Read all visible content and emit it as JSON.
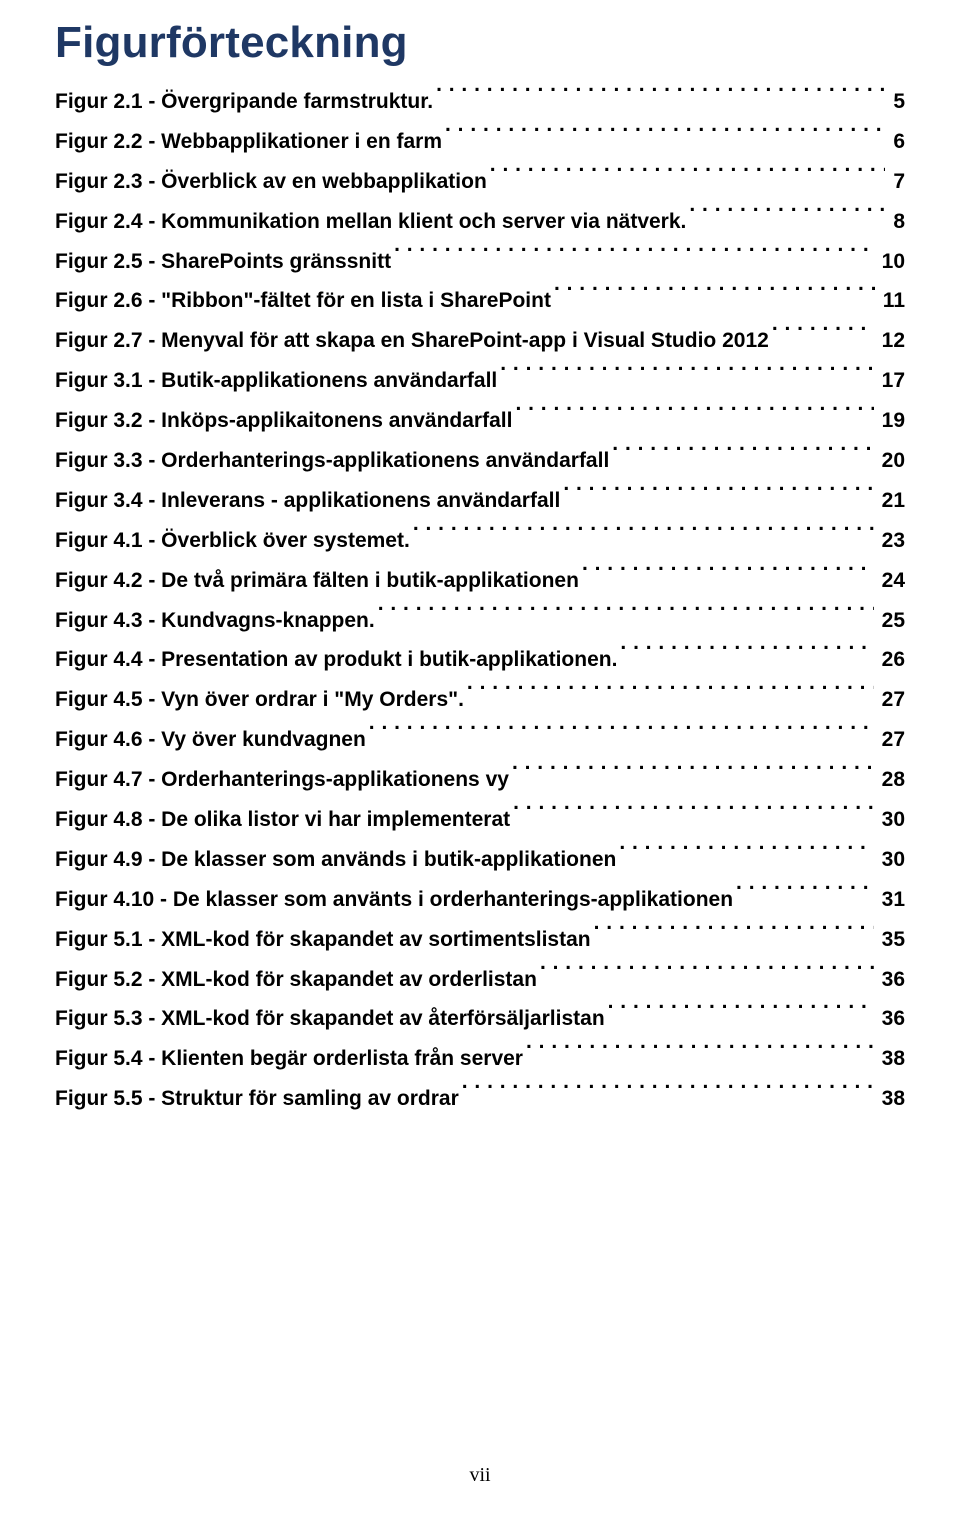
{
  "title": "Figurförteckning",
  "footer": "vii",
  "entries": [
    {
      "label": "Figur 2.1 - Övergripande farmstruktur.",
      "page": "5"
    },
    {
      "label": "Figur 2.2 - Webbapplikationer i en farm",
      "page": "6"
    },
    {
      "label": "Figur 2.3 - Överblick av en webbapplikation",
      "page": "7"
    },
    {
      "label": "Figur 2.4 - Kommunikation mellan klient och server via nätverk.",
      "page": "8"
    },
    {
      "label": "Figur 2.5 - SharePoints gränssnitt",
      "page": "10"
    },
    {
      "label": "Figur 2.6 - \"Ribbon\"-fältet för en lista i SharePoint",
      "page": "11"
    },
    {
      "label": "Figur 2.7 - Menyval för att skapa en SharePoint-app i Visual Studio 2012",
      "page": "12"
    },
    {
      "label": "Figur 3.1 - Butik-applikationens användarfall",
      "page": "17"
    },
    {
      "label": "Figur 3.2 - Inköps-applikaitonens användarfall",
      "page": "19"
    },
    {
      "label": "Figur 3.3 - Orderhanterings-applikationens användarfall",
      "page": "20"
    },
    {
      "label": "Figur 3.4 - Inleverans - applikationens användarfall",
      "page": "21"
    },
    {
      "label": "Figur 4.1 - Överblick över systemet.",
      "page": "23"
    },
    {
      "label": "Figur 4.2 - De två primära fälten i butik-applikationen",
      "page": "24"
    },
    {
      "label": "Figur 4.3 - Kundvagns-knappen.",
      "page": "25"
    },
    {
      "label": "Figur 4.4 - Presentation av produkt i butik-applikationen.",
      "page": "26"
    },
    {
      "label": "Figur 4.5 - Vyn över ordrar i \"My Orders\".",
      "page": "27"
    },
    {
      "label": "Figur 4.6 - Vy över kundvagnen",
      "page": "27"
    },
    {
      "label": "Figur 4.7 - Orderhanterings-applikationens vy",
      "page": "28"
    },
    {
      "label": "Figur 4.8 - De olika listor vi har implementerat",
      "page": "30"
    },
    {
      "label": "Figur 4.9 - De klasser som används i butik-applikationen",
      "page": "30"
    },
    {
      "label": "Figur 4.10 - De klasser som använts i orderhanterings-applikationen",
      "page": "31"
    },
    {
      "label": "Figur 5.1 - XML-kod för skapandet av sortimentslistan",
      "page": "35"
    },
    {
      "label": "Figur 5.2 - XML-kod för skapandet av orderlistan",
      "page": "36"
    },
    {
      "label": "Figur 5.3 - XML-kod för skapandet av återförsäljarlistan",
      "page": "36"
    },
    {
      "label": "Figur 5.4 - Klienten begär orderlista från server",
      "page": "38"
    },
    {
      "label": "Figur 5.5 - Struktur för samling av ordrar",
      "page": "38"
    }
  ]
}
